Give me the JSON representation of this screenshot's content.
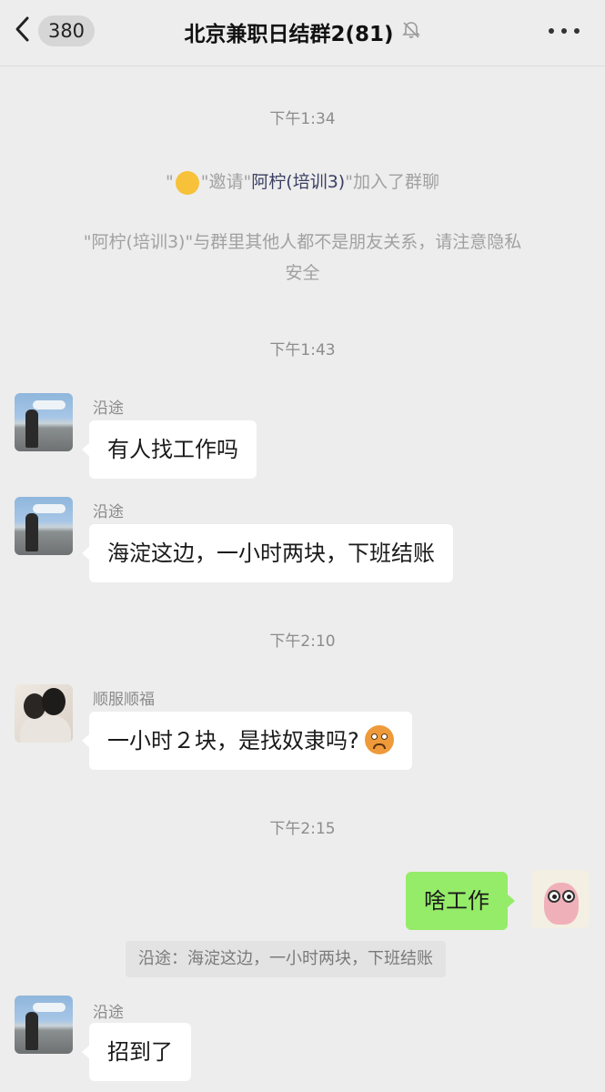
{
  "header": {
    "back_badge": "380",
    "title": "北京兼职日结群2(81)"
  },
  "messages": {
    "t1": "下午1:34",
    "invite_pre": "\"",
    "invite_mid": "\"邀请\"",
    "invite_name": "阿柠(培训3)",
    "invite_post": "\"加入了群聊",
    "privacy_line1": "\"阿柠(培训3)\"与群里其他人都不是朋友关系，请注意隐私",
    "privacy_line2": "安全",
    "t2": "下午1:43",
    "m1_sender": "沿途",
    "m1_text": "有人找工作吗",
    "m2_sender": "沿途",
    "m2_text": "海淀这边，一小时两块，下班结账",
    "t3": "下午2:10",
    "m3_sender": "顺服顺福",
    "m3_text": "一小时２块，是找奴隶吗?",
    "t4": "下午2:15",
    "m4_text": "啥工作",
    "m4_quote": "沿途：海淀这边，一小时两块，下班结账",
    "m5_sender": "沿途",
    "m5_text": "招到了"
  },
  "icons": {
    "back": "chevron-left-icon",
    "mute": "bell-off-icon",
    "more": "more-dots-icon",
    "invite_emoji": "wink-emoji-icon",
    "sad_emoji": "sad-face-emoji-icon"
  },
  "colors": {
    "background": "#ededed",
    "bubble_in": "#ffffff",
    "bubble_out": "#95ec69"
  }
}
